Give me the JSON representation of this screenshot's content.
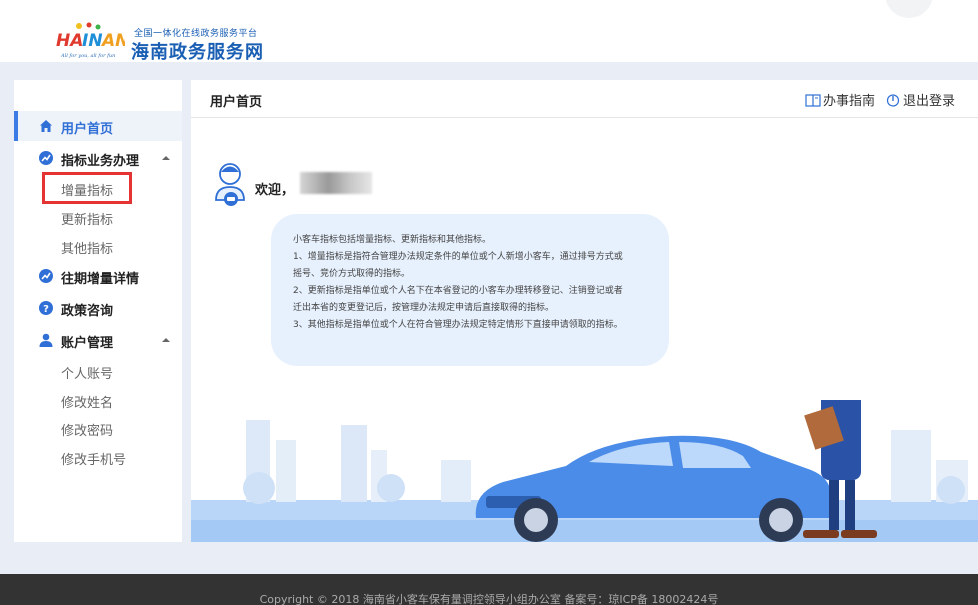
{
  "header": {
    "logo_text": "HAINAN",
    "logo_tagline": "All for you, all for fun",
    "subtitle": "全国一体化在线政务服务平台",
    "title": "海南政务服务网"
  },
  "sidebar": {
    "items": [
      {
        "label": "用户首页",
        "icon": "home-icon",
        "active": true
      },
      {
        "label": "指标业务办理",
        "icon": "trend-icon",
        "expanded": true,
        "children": [
          "增量指标",
          "更新指标",
          "其他指标"
        ]
      },
      {
        "label": "往期增量详情",
        "icon": "trend-icon"
      },
      {
        "label": "政策咨询",
        "icon": "question-icon"
      },
      {
        "label": "账户管理",
        "icon": "user-icon",
        "expanded": true,
        "children": [
          "个人账号",
          "修改姓名",
          "修改密码",
          "修改手机号"
        ]
      }
    ]
  },
  "main": {
    "title": "用户首页",
    "guide_label": "办事指南",
    "logout_label": "退出登录",
    "welcome": "欢迎，",
    "info": [
      "小客车指标包括增量指标、更新指标和其他指标。",
      "1、增量指标是指符合管理办法规定条件的单位或个人新增小客车，通过排号方式或",
      "摇号、竞价方式取得的指标。",
      "2、更新指标是指单位或个人名下在本省登记的小客车办理转移登记、注销登记或者",
      "迁出本省的变更登记后，按管理办法规定申请后直接取得的指标。",
      "3、其他指标是指单位或个人在符合管理办法规定特定情形下直接申请领取的指标。"
    ]
  },
  "footer": {
    "text": "Copyright  © 2018   海南省小客车保有量调控领导小组办公室    备案号：琼ICP备 18002424号"
  },
  "colors": {
    "accent": "#2f6fd6",
    "highlight": "#e53333",
    "footer_bg": "#333333"
  }
}
